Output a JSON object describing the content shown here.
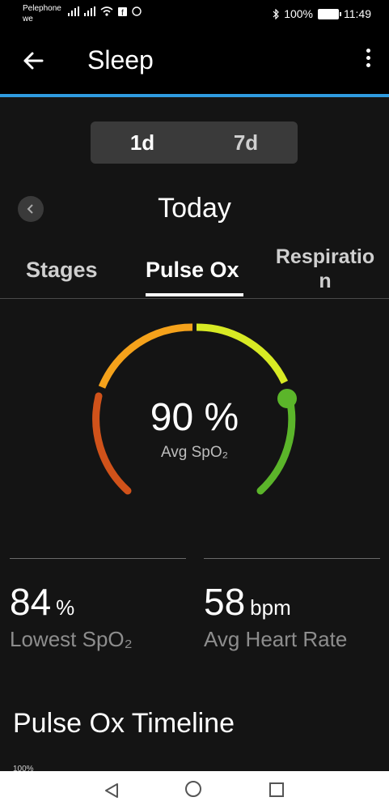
{
  "status_bar": {
    "carrier_line1": "Pelephone",
    "carrier_line2": "we",
    "battery": "100%",
    "time": "11:49"
  },
  "app_bar": {
    "title": "Sleep",
    "back_icon": "arrow-left-icon",
    "more_icon": "more-vertical-icon"
  },
  "range_toggle": {
    "options": [
      "1d",
      "7d"
    ],
    "selected": "1d"
  },
  "date_nav": {
    "label": "Today",
    "prev_icon": "chevron-left-icon"
  },
  "tabs": [
    {
      "label": "Stages"
    },
    {
      "label": "Pulse Ox",
      "selected": true
    },
    {
      "label_line1": "Respiratio",
      "label_line2": "n"
    }
  ],
  "gauge": {
    "value_text": "90 %",
    "label": "Avg SpO₂",
    "colors": {
      "low": "#d0521a",
      "mid": "#f5a21b",
      "high": "#d8ea24",
      "good": "#5bb52a"
    }
  },
  "stats": [
    {
      "value": "84",
      "unit": "%",
      "label": "Lowest SpO₂"
    },
    {
      "value": "58",
      "unit": "bpm",
      "label": "Avg Heart Rate"
    }
  ],
  "timeline": {
    "title": "Pulse Ox Timeline",
    "axis_top": "100%"
  },
  "colors": {
    "accent": "#2f9be0",
    "background": "#141414"
  }
}
